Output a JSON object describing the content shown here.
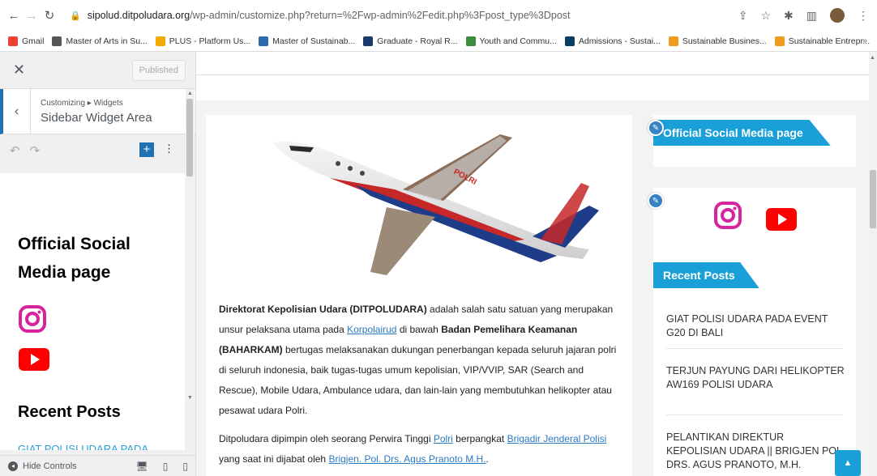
{
  "browser": {
    "url_host": "sipolud.ditpoludara.org",
    "url_path": "/wp-admin/customize.php?return=%2Fwp-admin%2Fedit.php%3Fpost_type%3Dpost",
    "bookmarks": [
      {
        "label": "Gmail",
        "color": "#ea4335"
      },
      {
        "label": "Master of Arts in Su...",
        "color": "#555555"
      },
      {
        "label": "PLUS - Platform Us...",
        "color": "#f2a900"
      },
      {
        "label": "Master of Sustainab...",
        "color": "#2b6cb0"
      },
      {
        "label": "Graduate - Royal R...",
        "color": "#1a3a6b"
      },
      {
        "label": "Youth and Commu...",
        "color": "#3c8d40"
      },
      {
        "label": "Admissions - Sustai...",
        "color": "#0a3d62"
      },
      {
        "label": "Sustainable Busines...",
        "color": "#f29c1f"
      },
      {
        "label": "Sustainable Entrepr...",
        "color": "#f29c1f"
      }
    ],
    "bookmarks_more": "»"
  },
  "customizer": {
    "published_label": "Published",
    "breadcrumb": "Customizing ▸ Widgets",
    "section_title": "Sidebar Widget Area",
    "widget_title": "Official Social Media page",
    "recent_posts_title": "Recent Posts",
    "recent_post_preview": "GIAT POLISI UDARA PADA",
    "hide_controls_label": "Hide Controls"
  },
  "article": {
    "p1_bold1": "Direktorat Kepolisian Udara (DITPOLUDARA)",
    "p1_t1": " adalah salah satu satuan yang merupakan unsur pelaksana utama pada ",
    "p1_link1": "Korpolairud",
    "p1_t2": " di bawah ",
    "p1_bold2": "Badan Pemelihara Keamanan (BAHARKAM)",
    "p1_t3": " bertugas melaksanakan dukungan penerbangan kepada seluruh jajaran polri di seluruh indonesia, baik tugas-tugas umum kepolisian, VIP/VVIP, SAR (Search and Rescue), Mobile Udara, Ambulance udara, dan lain-lain yang membutuhkan helikopter atau pesawat udara Polri.",
    "p2_t1": "Ditpoludara dipimpin oleh seorang Perwira Tinggi ",
    "p2_link1": "Polri",
    "p2_t2": " berpangkat ",
    "p2_link2": "Brigadir Jenderal Polisi",
    "p2_t3": " yang saat ini dijabat oleh ",
    "p2_link3": "Brigjen. Pol. Drs. Agus Pranoto M.H.",
    "p2_t4": ".",
    "plane_livery": "POLRI"
  },
  "sidebar": {
    "social_title": "Official Social Media page",
    "recent_title": "Recent Posts",
    "posts": [
      "GIAT POLISI UDARA PADA EVENT G20 DI BALI",
      "TERJUN PAYUNG DARI HELIKOPTER AW169 POLISI UDARA",
      "PELANTIKAN DIREKTUR KEPOLISIAN UDARA || BRIGJEN POL Drs. AGUS PRANOTO, M.H."
    ]
  },
  "colors": {
    "accent": "#1aa0d9",
    "wp_blue": "#2271b1",
    "instagram": "#d6249f",
    "youtube": "#ff0000"
  }
}
